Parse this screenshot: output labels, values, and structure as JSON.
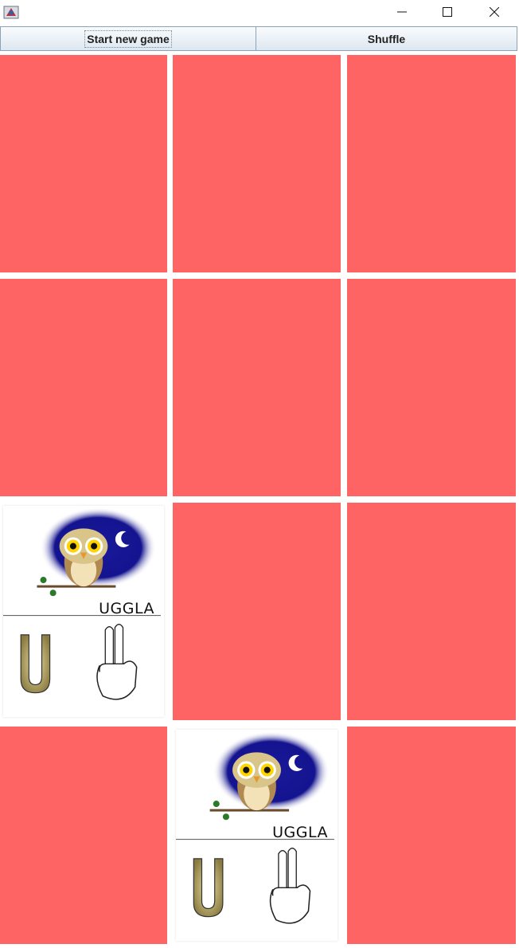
{
  "window": {
    "icon": "java-app-icon",
    "controls": [
      "minimize-icon",
      "maximize-icon",
      "close-icon"
    ]
  },
  "toolbar": {
    "start_label": "Start new game",
    "shuffle_label": "Shuffle"
  },
  "board": {
    "rows": 4,
    "cols": 3,
    "card_back_color": "#ff6464",
    "cards": [
      {
        "state": "hidden"
      },
      {
        "state": "hidden"
      },
      {
        "state": "hidden"
      },
      {
        "state": "hidden"
      },
      {
        "state": "hidden"
      },
      {
        "state": "hidden"
      },
      {
        "state": "revealed",
        "word": "UGGLA",
        "letter": "U",
        "image": "owl-card"
      },
      {
        "state": "hidden"
      },
      {
        "state": "hidden"
      },
      {
        "state": "hidden"
      },
      {
        "state": "revealed",
        "word": "UGGLA",
        "letter": "U",
        "image": "owl-card"
      },
      {
        "state": "hidden"
      }
    ]
  }
}
